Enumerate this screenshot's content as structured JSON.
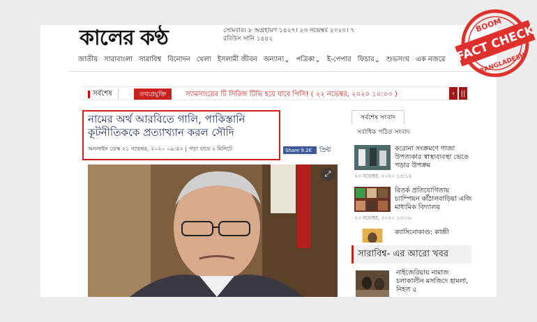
{
  "site": {
    "masthead": "কালের কণ্ঠ",
    "date_line1": "সোমবার। ৮ অগ্রহায়ণ ১৪২৭। ২৩ নভেম্বর ২০২০। ৭",
    "date_line2": "রবিউস সানি ১৪৪২"
  },
  "nav": {
    "items": [
      "জাতীয়",
      "সারাবাংলা",
      "সারাবিশ্ব",
      "বিনোদন",
      "খেলা",
      "ইসলামী জীবন",
      "অন্যান্য",
      "পত্রিকা",
      "ই-পেপার",
      "ফিচার",
      "শুভসংঘ",
      "এক নজরে"
    ]
  },
  "ticker": {
    "latest_label": "সর্বশেষ",
    "category": "তথ্যপ্রযুক্তি",
    "text": "স্যামসাংয়ের টি সিরিজ টিভি হয়ে যাবে পিসি! ( ২২ নভেম্বর, ২০২০ ১০:০৩ )",
    "prev": "‹",
    "pause": "||"
  },
  "article": {
    "headline": "নামের অর্থ আরবিতে গালি, পাকিস্তানি কূটনীতিককে প্রত্যাখ্যান করল সৌদি",
    "byline": "অনলাইন ডেস্ক  ২১ নভেম্বর, ২০২০ ০৯:৪২ | পড়া যাবে ২ মিনিটে",
    "share_label": "Share 9.2K",
    "print_label": "প্রিন্ট",
    "expand_icon": "⤢"
  },
  "sidebar": {
    "tab_latest": "সর্বশেষ সংবাদ",
    "tab_most_read": "সর্বাধিক পঠিত সংবাদ",
    "items": [
      {
        "title": "করোনা সংক্রমণে গাজা উপত্যকার স্বাস্থ্যব্যবস্থা ভেঙে পড়ার উপক্রম",
        "time": "২৩ নভেম্বর, ২০২০ ১৩:১২"
      },
      {
        "title": "বিতর্ক প্রতিযোগিতায় চ্যাম্পিয়ন কাঁঠালবাড়িয়া এজি মাধ্যমিক বিদ্যালয়",
        "time": "২৩ নভেম্বর, ২০২০ ১৩:০৮"
      },
      {
        "title": "ক্যাসিনোকাণ্ড: কাজী",
        "time": ""
      }
    ],
    "more_heading": "সারাবিশ্ব- এর আরো খবর",
    "more_items": [
      {
        "title": "নাইজেরিয়ায় নামাজ চলাকালীন মসজিদে হামলা, নিহত ৫"
      }
    ]
  },
  "stamp": {
    "top": "BOOM",
    "main": "FACT CHECK",
    "bottom": "BANGLADESH",
    "color": "#e0302b"
  }
}
